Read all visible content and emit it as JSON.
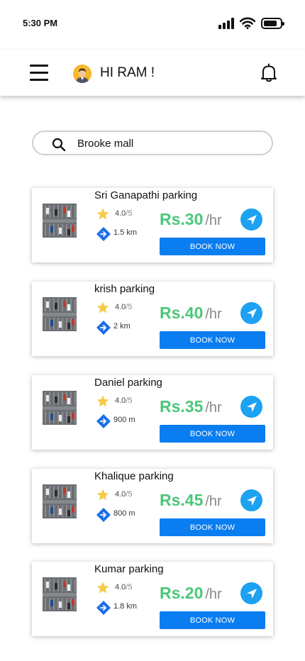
{
  "status_bar": {
    "time": "5:30 PM"
  },
  "header": {
    "greeting": "HI RAM !"
  },
  "search": {
    "value": "Brooke mall"
  },
  "colors": {
    "accent_blue": "#0a7df0",
    "price_green": "#4cc77a",
    "star_yellow": "#f7c948",
    "nav_blue": "#1da1f2"
  },
  "parkings": [
    {
      "name": "Sri Ganapathi parking",
      "rating": "4.0",
      "rating_max": "/5",
      "distance": "1.5 km",
      "price": "Rs.30",
      "unit": "/hr",
      "button": "BOOK NOW"
    },
    {
      "name": "krish parking",
      "rating": "4.0",
      "rating_max": "/5",
      "distance": "2 km",
      "price": "Rs.40",
      "unit": "/hr",
      "button": "BOOK NOW"
    },
    {
      "name": "Daniel parking",
      "rating": "4.0",
      "rating_max": "/5",
      "distance": "900 m",
      "price": "Rs.35",
      "unit": "/hr",
      "button": "BOOK NOW"
    },
    {
      "name": "Khalique parking",
      "rating": "4.0",
      "rating_max": "/5",
      "distance": "800 m",
      "price": "Rs.45",
      "unit": "/hr",
      "button": "BOOK NOW"
    },
    {
      "name": "Kumar parking",
      "rating": "4.0",
      "rating_max": "/5",
      "distance": "1.8 km",
      "price": "Rs.20",
      "unit": "/hr",
      "button": "BOOK NOW"
    }
  ]
}
